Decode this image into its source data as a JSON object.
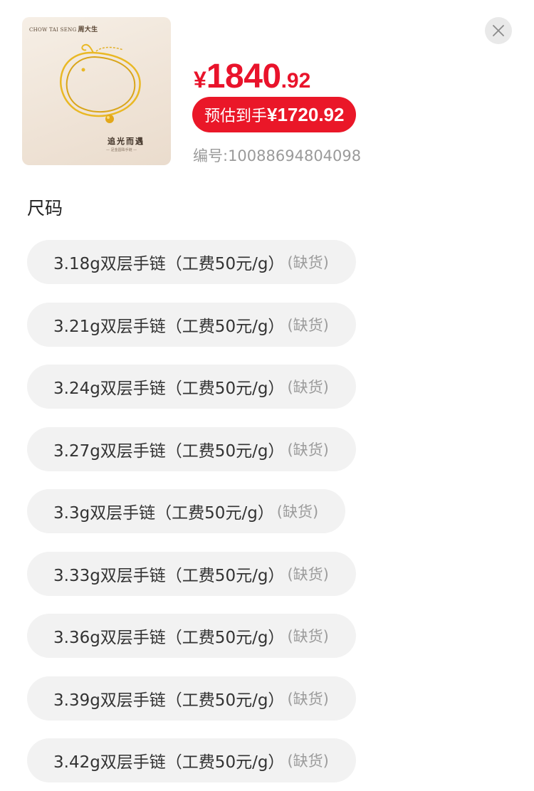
{
  "product": {
    "image": {
      "brand_en": "CHOW TAI SENG",
      "brand_cn": "周大生",
      "slogan": "追光而遇",
      "subtitle": "— 足金圆珠手链 —",
      "metal_color": "#e9b824"
    },
    "price": {
      "currency": "¥",
      "integer": "1840",
      "decimal": ".92",
      "color": "#e9132b"
    },
    "estimate": {
      "label": "预估到手",
      "amount": "¥1720.92",
      "bg_color": "#ea1728"
    },
    "sku": "编号:10088694804098"
  },
  "close_icon": "close-icon",
  "size_section": {
    "title": "尺码",
    "options": [
      {
        "name": "3.18g双层手链（工费50元/g）",
        "status": "(缺货)"
      },
      {
        "name": "3.21g双层手链（工费50元/g）",
        "status": "(缺货)"
      },
      {
        "name": "3.24g双层手链（工费50元/g）",
        "status": "(缺货)"
      },
      {
        "name": "3.27g双层手链（工费50元/g）",
        "status": "(缺货)"
      },
      {
        "name": "3.3g双层手链（工费50元/g）",
        "status": "(缺货)"
      },
      {
        "name": "3.33g双层手链（工费50元/g）",
        "status": "(缺货)"
      },
      {
        "name": "3.36g双层手链（工费50元/g）",
        "status": "(缺货)"
      },
      {
        "name": "3.39g双层手链（工费50元/g）",
        "status": "(缺货)"
      },
      {
        "name": "3.42g双层手链（工费50元/g）",
        "status": "(缺货)"
      }
    ]
  }
}
